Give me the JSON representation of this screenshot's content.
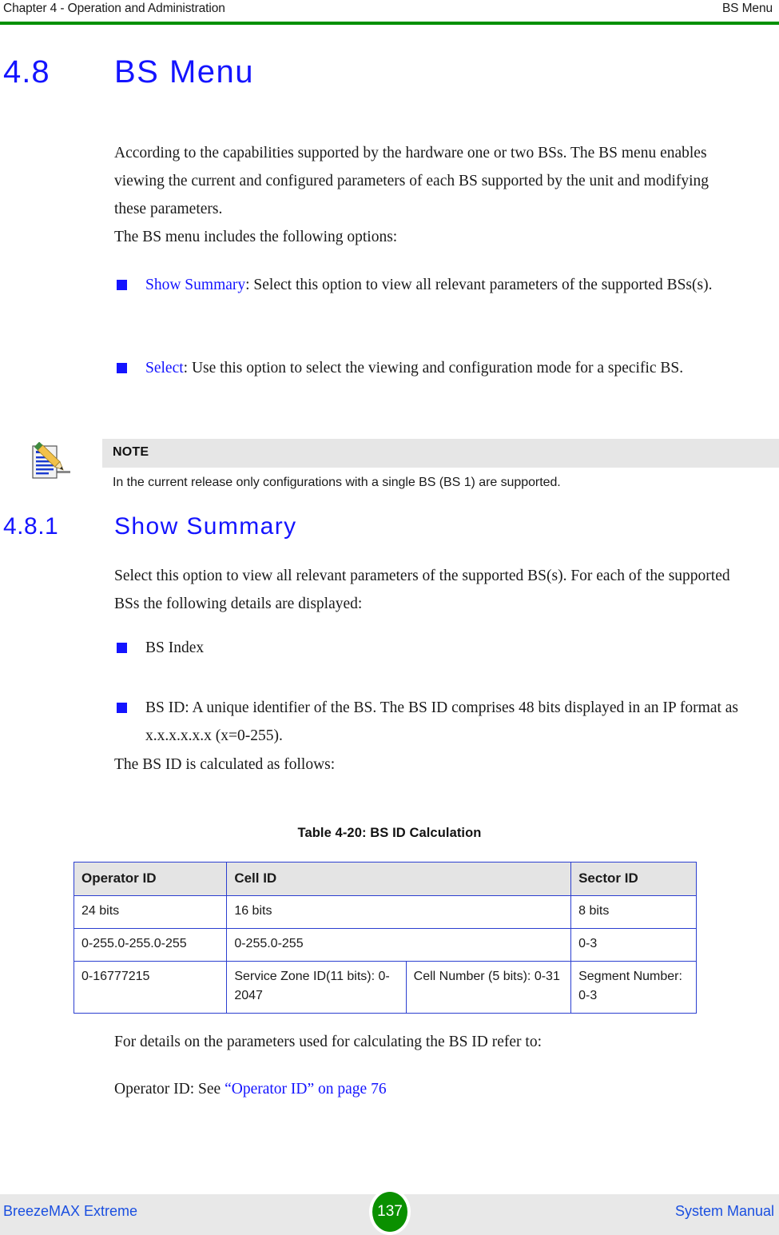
{
  "header": {
    "left": "Chapter 4 - Operation and Administration",
    "right": "BS Menu",
    "rule_color": "#009000"
  },
  "headings": {
    "h1_number": "4.8",
    "h1_title": "BS Menu",
    "h2_number": "4.8.1",
    "h2_title": "Show Summary",
    "heading_color": "#1414ff"
  },
  "paragraphs": {
    "intro": "According to the capabilities supported by the hardware one or two BSs. The BS menu enables viewing the current and configured parameters of each BS supported by the unit and modifying these parameters.",
    "options_lead": "The BS menu includes the following options:",
    "show_summary_intro": "Select this option to view all relevant parameters of the supported BS(s). For each of the supported BSs the following details are displayed:",
    "bsid_calc_lead": "The BS ID is calculated as follows:",
    "details_lead": "For details on the parameters used for calculating the BS ID refer to:"
  },
  "menu_bullets": [
    {
      "term": "Show Summary",
      "rest": ": Select this option to view all relevant parameters of the supported BSs(s)."
    },
    {
      "term": "Select",
      "rest": ": Use this option to select the viewing and configuration mode for a specific BS."
    }
  ],
  "detail_bullets": [
    {
      "text": "BS Index"
    },
    {
      "text": "BS ID: A unique identifier of the BS. The BS ID comprises 48 bits displayed in an IP format as x.x.x.x.x.x (x=0-255)."
    }
  ],
  "note": {
    "icon": "note-pencil-icon",
    "label": "NOTE",
    "text": "In the current release only configurations with a single BS (BS 1) are supported.",
    "header_bg": "#e6e6e6"
  },
  "table": {
    "caption": "Table 4-20: BS ID Calculation",
    "border_color": "#2b3fd0",
    "header_bg": "#e4e4e4",
    "columns": [
      "Operator ID",
      "Cell ID",
      "Sector ID"
    ],
    "rows": [
      {
        "operator": "24 bits",
        "cell": "16 bits",
        "sector": "8 bits"
      },
      {
        "operator": "0-255.0-255.0-255",
        "cell": "0-255.0-255",
        "sector": "0-3"
      },
      {
        "operator": "0-16777215",
        "cell_a": "Service Zone ID(11 bits): 0-2047",
        "cell_b": "Cell Number (5 bits): 0-31",
        "sector": "Segment Number: 0-3"
      }
    ]
  },
  "crossref": {
    "prefix": "Operator ID: See ",
    "link": "“Operator ID” on page 76"
  },
  "footer": {
    "left": "BreezeMAX Extreme",
    "page": "137",
    "right": "System Manual",
    "badge_color": "#0a9000",
    "bar_color": "#e8e8e8"
  }
}
